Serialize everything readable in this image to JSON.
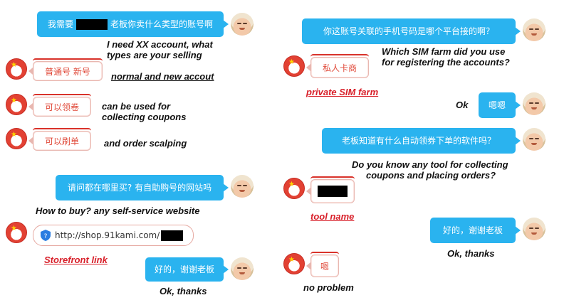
{
  "left": {
    "msg1": {
      "pre": "我需要",
      "post": "老板你卖什么类型的账号啊"
    },
    "note1": [
      "I need XX account, what",
      "types are your selling"
    ],
    "reply1": "普通号 新号",
    "note2": "normal and new accout",
    "reply2": "可以领卷",
    "note3": [
      "can be used for",
      "collecting coupons"
    ],
    "reply3": "可以刷单",
    "note4": "and order scalping",
    "msg2": "请问都在哪里买? 有自助购号的网站吗",
    "note5": "How to buy? any self-service website",
    "link": "http://shop.91kami.com/",
    "note6": "Storefront link",
    "msg3": "好的，谢谢老板",
    "note7": "Ok, thanks"
  },
  "right": {
    "msg1": "你这账号关联的手机号码是哪个平台接的啊？",
    "note1": [
      "Which SIM farm did you use",
      "for registering the accounts?"
    ],
    "reply1": "私人卡商",
    "note2": "private SIM farm",
    "msg2": "嗯嗯",
    "note3": "Ok",
    "msg3": "老板知道有什么自动领券下单的软件吗？",
    "note4": [
      "Do you know any tool for collecting",
      "coupons and placing orders?"
    ],
    "note5": "tool name",
    "msg4": "好的，谢谢老板",
    "note6": "Ok, thanks",
    "reply3": "嗯",
    "note7": "no problem"
  },
  "colors": {
    "bubble": "#2ab3ef",
    "card_text": "#e04a3a",
    "annotation_red": "#d8202a"
  },
  "icons": {
    "shop_avatar": "red-badge-avatar",
    "buyer_avatar": "face-avatar",
    "link_icon": "shield-icon"
  }
}
